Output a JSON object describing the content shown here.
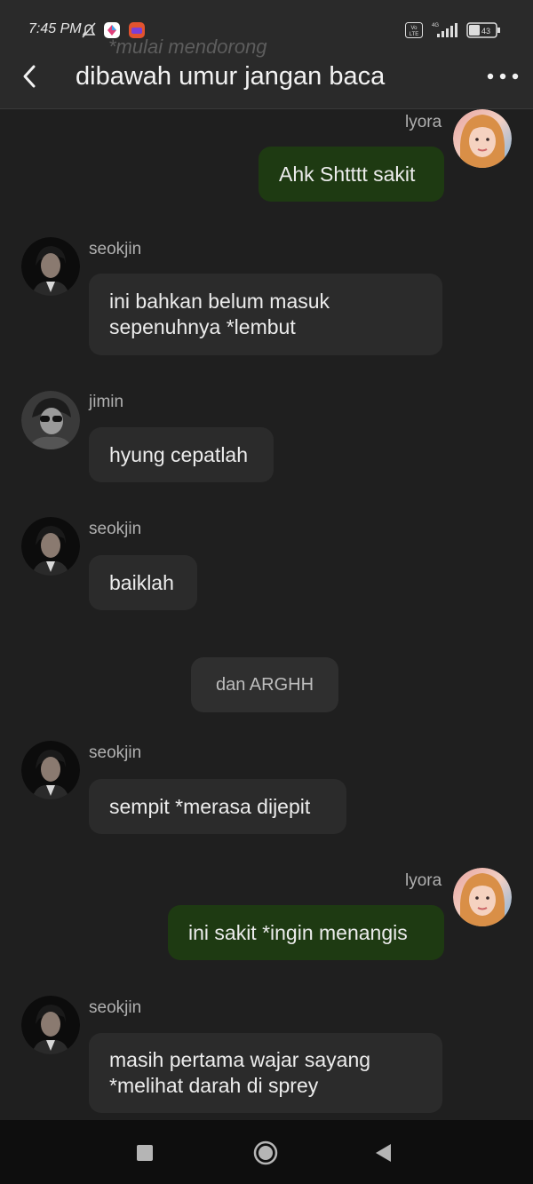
{
  "status_bar": {
    "time": "7:45 PM",
    "battery": "43",
    "network": "4G",
    "volte": "Vo LTE"
  },
  "header": {
    "title": "dibawah umur jangan baca",
    "ghost_text": "*mulai mendorong"
  },
  "messages": [
    {
      "sender": "lyora",
      "side": "out",
      "avatar": "lyora-avatar",
      "text": "Ahk Shtttt sakit"
    },
    {
      "sender": "seokjin",
      "side": "in",
      "avatar": "seokjin-avatar",
      "lines": [
        "ini bahkan belum masuk",
        "sepenuhnya *lembut"
      ]
    },
    {
      "sender": "jimin",
      "side": "in",
      "avatar": "jimin-avatar",
      "text": "hyung cepatlah"
    },
    {
      "sender": "seokjin",
      "side": "in",
      "avatar": "seokjin-avatar",
      "text": "baiklah"
    },
    {
      "side": "narration",
      "text": "dan ARGHH"
    },
    {
      "sender": "seokjin",
      "side": "in",
      "avatar": "seokjin-avatar",
      "text": "sempit *merasa dijepit"
    },
    {
      "sender": "lyora",
      "side": "out",
      "avatar": "lyora-avatar",
      "text": "ini sakit *ingin menangis"
    },
    {
      "sender": "seokjin",
      "side": "in",
      "avatar": "seokjin-avatar",
      "lines": [
        "masih pertama wajar sayang",
        "*melihat darah di sprey"
      ]
    }
  ],
  "colors": {
    "background": "#1f1f1f",
    "incoming_bubble": "#2b2b2b",
    "outgoing_bubble": "#1e3a12",
    "header": "#2a2a2a"
  },
  "nav_icons": [
    "recents-icon",
    "home-icon",
    "back-icon"
  ]
}
